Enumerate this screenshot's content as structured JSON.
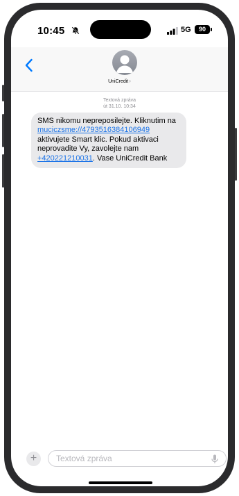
{
  "status_bar": {
    "time": "10:45",
    "network": "5G",
    "battery": "90"
  },
  "header": {
    "contact_name": "UniCredit",
    "chevron": "›"
  },
  "message": {
    "meta_label": "Textová zpráva",
    "meta_date": "út 31.10. 10:34",
    "text_1": "SMS nikomu nepreposilejte. Kliknutim na ",
    "link_url": "muciczsme://4793516384106949",
    "text_2": " aktivujete Smart klic. Pokud aktivaci neprovadite Vy, zavolejte nam ",
    "link_phone": "+420221210031",
    "text_3": ". Vase UniCredit Bank"
  },
  "composer": {
    "placeholder": "Textová zpráva",
    "plus": "+"
  },
  "icons": {
    "back": "chevron-left-icon",
    "bell": "bell-slash-icon",
    "signal": "cellular-signal-icon",
    "mic": "microphone-icon",
    "avatar": "person-silhouette-icon"
  },
  "colors": {
    "accent": "#007aff",
    "link": "#1a73e8",
    "bubble": "#e9e9eb",
    "meta_text": "#8e8e93"
  }
}
